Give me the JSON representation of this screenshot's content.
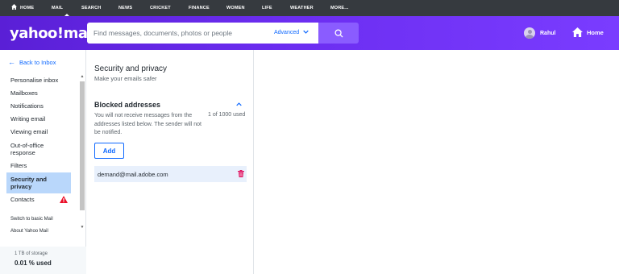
{
  "topnav": {
    "items": [
      {
        "label": "HOME"
      },
      {
        "label": "MAIL"
      },
      {
        "label": "SEARCH"
      },
      {
        "label": "NEWS"
      },
      {
        "label": "CRICKET"
      },
      {
        "label": "FINANCE"
      },
      {
        "label": "WOMEN"
      },
      {
        "label": "LIFE"
      },
      {
        "label": "WEATHER"
      },
      {
        "label": "MORE..."
      }
    ],
    "active": "MAIL"
  },
  "header": {
    "logo": "yahoo!mail",
    "search_placeholder": "Find messages, documents, photos or people",
    "advanced_label": "Advanced",
    "user_name": "Rahul",
    "home_label": "Home"
  },
  "sidebar": {
    "back_label": "Back to Inbox",
    "items": [
      {
        "label": "Personalise inbox"
      },
      {
        "label": "Mailboxes"
      },
      {
        "label": "Notifications"
      },
      {
        "label": "Writing email"
      },
      {
        "label": "Viewing email"
      },
      {
        "label": "Out-of-office response"
      },
      {
        "label": "Filters"
      },
      {
        "label": "Security and privacy"
      },
      {
        "label": "Contacts"
      }
    ],
    "active_item": "Security and privacy",
    "switch_basic": "Switch to basic Mail",
    "about": "About Yahoo Mail",
    "storage_total": "1 TB of storage",
    "storage_used": "0.01 % used"
  },
  "security": {
    "title": "Security and privacy",
    "subtitle": "Make your emails safer",
    "section_title": "Blocked addresses",
    "description": "You will not receive messages from the addresses listed below. The sender will not be notified.",
    "count": "1 of 1000 used",
    "add_label": "Add",
    "blocked": [
      {
        "email": "demand@mail.adobe.com"
      }
    ]
  },
  "colors": {
    "accent": "#0f69ff",
    "header_gradient_start": "#5a1fd6",
    "header_gradient_end": "#7a3cff",
    "active_item_bg": "#b9d7fb",
    "warning": "#eb0f29",
    "trash": "#e0115f"
  },
  "icons": {
    "home": "home-icon",
    "search": "search-icon",
    "warning": "warning-icon",
    "trash": "trash-icon"
  }
}
